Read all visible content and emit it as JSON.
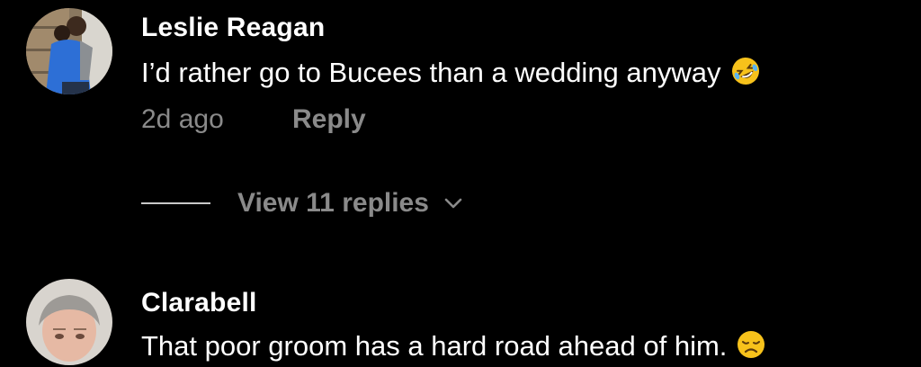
{
  "comments": [
    {
      "author": "Leslie Reagan",
      "text": "I’d rather go to Bucees than a wedding anyway",
      "emoji": "rolling-on-floor-laughing-emoji",
      "time": "2d ago",
      "reply_label": "Reply",
      "view_replies_label": "View 11 replies"
    },
    {
      "author": "Clarabell",
      "text": "That poor groom has a hard road ahead of him.",
      "emoji": "disappointed-face-emoji"
    }
  ],
  "colors": {
    "background": "#000000",
    "primary_text": "#ffffff",
    "secondary_text": "#8a8a8a",
    "emoji_yellow": "#f7c21b"
  }
}
